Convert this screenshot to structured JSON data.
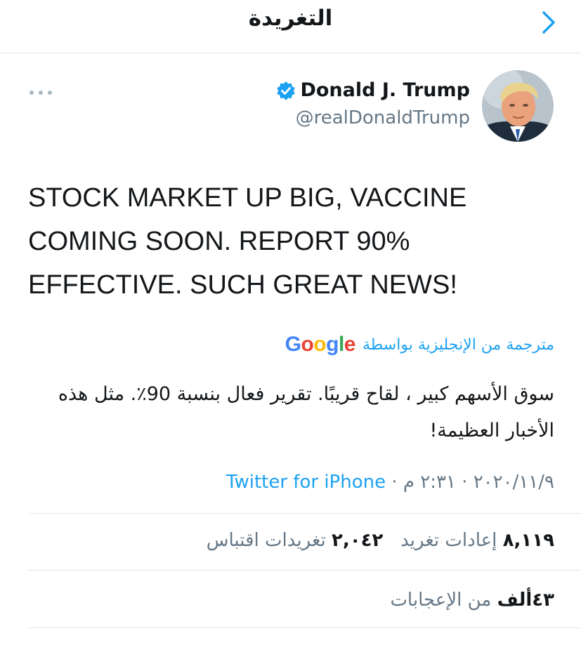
{
  "nav": {
    "title": "التغريدة",
    "back_icon": "chevron-icon"
  },
  "author": {
    "name": "Donald J. Trump",
    "handle": "@realDonaldTrump",
    "verified": true,
    "avatar_icon": "avatar-image"
  },
  "tweet": {
    "lines": [
      "STOCK MARKET UP BIG, VACCINE",
      "COMING SOON. REPORT 90%",
      "EFFECTIVE. SUCH GREAT NEWS!"
    ]
  },
  "translation": {
    "label": "مترجمة من الإنجليزية بواسطة",
    "provider": "Google",
    "lines": [
      "سوق الأسهم كبير ، لقاح قريبًا. تقرير فعال بنسبة 90٪. مثل هذه",
      "الأخبار العظيمة!"
    ]
  },
  "meta": {
    "date": "٢٠٢٠/١١/٩",
    "separator": " · ",
    "time": "٢:٣١ م",
    "source": "Twitter for iPhone"
  },
  "stats": {
    "retweets_count": "٨,١١٩",
    "retweets_label": "إعادات تغريد",
    "quotes_count": "٢,٠٤٢",
    "quotes_label": "تغريدات اقتباس",
    "likes_count": "٤٣ألف",
    "likes_label": "من الإعجابات"
  },
  "colors": {
    "accent": "#1da1f2",
    "secondary_text": "#657786",
    "divider": "#e1e8ed"
  }
}
